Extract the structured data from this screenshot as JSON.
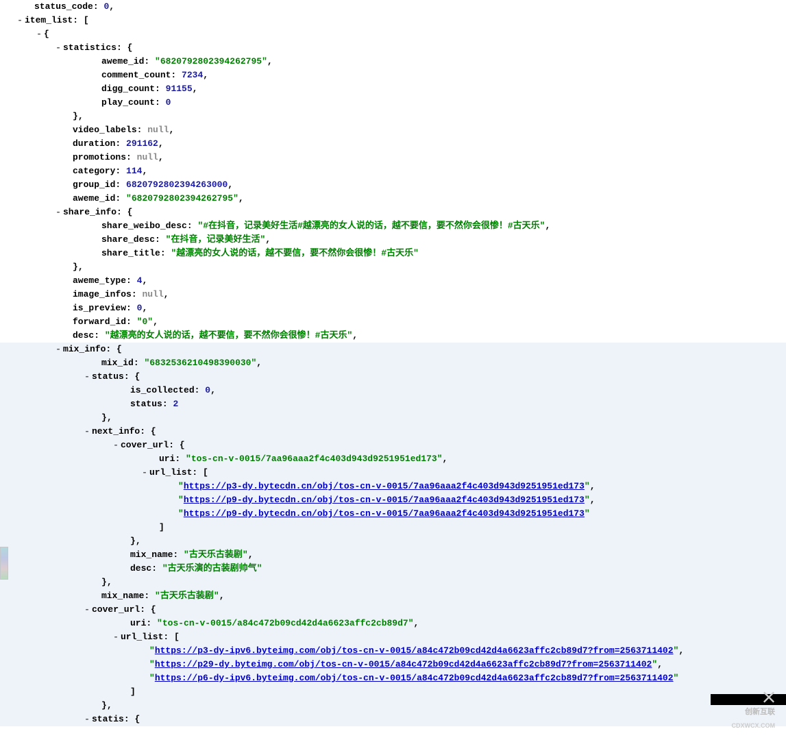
{
  "toggle_glyph": "-",
  "top_truncated_key": "status_code",
  "item_list_key": "item_list",
  "open_bracket": "[",
  "open_brace": "{",
  "close_brace": "}",
  "close_bracket": "]",
  "comma": ",",
  "colon": ":",
  "null_text": "null",
  "item": {
    "statistics": {
      "key": "statistics",
      "aweme_id": {
        "k": "aweme_id",
        "v": "6820792802394262795"
      },
      "comment_count": {
        "k": "comment_count",
        "v": "7234"
      },
      "digg_count": {
        "k": "digg_count",
        "v": "91155"
      },
      "play_count": {
        "k": "play_count",
        "v": "0"
      }
    },
    "video_labels": {
      "k": "video_labels"
    },
    "duration": {
      "k": "duration",
      "v": "291162"
    },
    "promotions": {
      "k": "promotions"
    },
    "category": {
      "k": "category",
      "v": "114"
    },
    "group_id": {
      "k": "group_id",
      "v": "6820792802394263000"
    },
    "aweme_id": {
      "k": "aweme_id",
      "v": "6820792802394262795"
    },
    "share_info": {
      "key": "share_info",
      "share_weibo_desc": {
        "k": "share_weibo_desc",
        "v": "#在抖音，记录美好生活#越漂亮的女人说的话，越不要信，要不然你会很惨！#古天乐"
      },
      "share_desc": {
        "k": "share_desc",
        "v": "在抖音，记录美好生活"
      },
      "share_title": {
        "k": "share_title",
        "v": "越漂亮的女人说的话，越不要信，要不然你会很惨！#古天乐"
      }
    },
    "aweme_type": {
      "k": "aweme_type",
      "v": "4"
    },
    "image_infos": {
      "k": "image_infos"
    },
    "is_preview": {
      "k": "is_preview",
      "v": "0"
    },
    "forward_id": {
      "k": "forward_id",
      "v": "0"
    },
    "desc": {
      "k": "desc",
      "v": "越漂亮的女人说的话，越不要信，要不然你会很惨！#古天乐"
    },
    "mix_info": {
      "key": "mix_info",
      "mix_id": {
        "k": "mix_id",
        "v": "6832536210498390030"
      },
      "status": {
        "key": "status",
        "is_collected": {
          "k": "is_collected",
          "v": "0"
        },
        "status": {
          "k": "status",
          "v": "2"
        }
      },
      "next_info": {
        "key": "next_info",
        "cover_url": {
          "key": "cover_url",
          "uri": {
            "k": "uri",
            "v": "tos-cn-v-0015/7aa96aaa2f4c403d943d9251951ed173"
          },
          "url_list_key": "url_list",
          "urls": {
            "u0": "https://p3-dy.bytecdn.cn/obj/tos-cn-v-0015/7aa96aaa2f4c403d943d9251951ed173",
            "u1": "https://p9-dy.bytecdn.cn/obj/tos-cn-v-0015/7aa96aaa2f4c403d943d9251951ed173",
            "u2": "https://p9-dy.bytecdn.cn/obj/tos-cn-v-0015/7aa96aaa2f4c403d943d9251951ed173"
          }
        },
        "mix_name": {
          "k": "mix_name",
          "v": "古天乐古装剧"
        },
        "desc": {
          "k": "desc",
          "v": "古天乐演的古装剧帅气"
        }
      },
      "mix_name": {
        "k": "mix_name",
        "v": "古天乐古装剧"
      },
      "cover_url": {
        "key": "cover_url",
        "uri": {
          "k": "uri",
          "v": "tos-cn-v-0015/a84c472b09cd42d4a6623affc2cb89d7"
        },
        "url_list_key": "url_list",
        "urls": {
          "u0": "https://p3-dy-ipv6.byteimg.com/obj/tos-cn-v-0015/a84c472b09cd42d4a6623affc2cb89d7?from=2563711402",
          "u1": "https://p29-dy.byteimg.com/obj/tos-cn-v-0015/a84c472b09cd42d4a6623affc2cb89d7?from=2563711402",
          "u2": "https://p6-dy-ipv6.byteimg.com/obj/tos-cn-v-0015/a84c472b09cd42d4a6623affc2cb89d7?from=2563711402"
        }
      },
      "statis_key": "statis"
    }
  },
  "watermark": {
    "brand": "创新互联",
    "sub": "CDXWCX.COM"
  }
}
